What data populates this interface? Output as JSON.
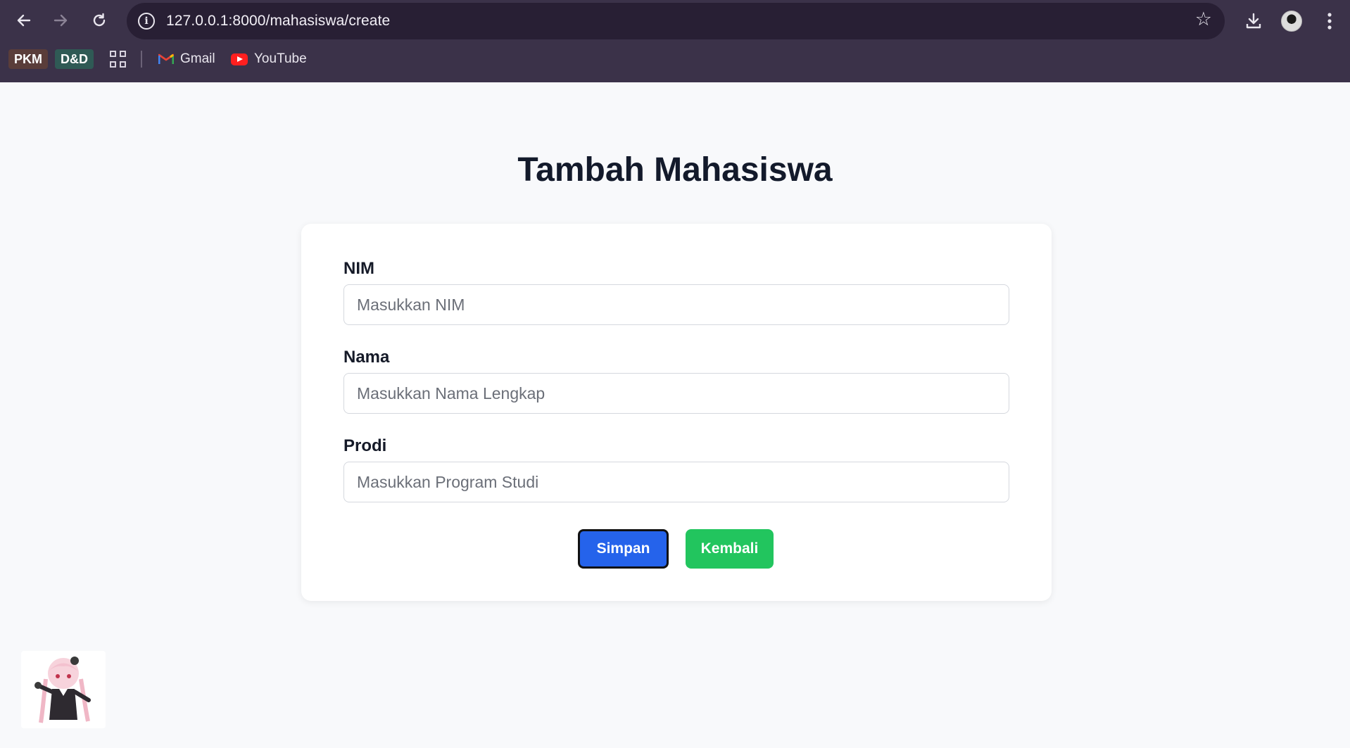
{
  "browser": {
    "url": "127.0.0.1:8000/mahasiswa/create",
    "bookmarks": [
      {
        "label": "PKM",
        "bg": "#5a3d3a"
      },
      {
        "label": "D&D",
        "bg": "#2f5a55"
      },
      {
        "label": "Gmail",
        "icon": "gmail-icon"
      },
      {
        "label": "YouTube",
        "icon": "youtube-icon"
      }
    ]
  },
  "page": {
    "title": "Tambah Mahasiswa",
    "fields": [
      {
        "label": "NIM",
        "placeholder": "Masukkan NIM",
        "value": ""
      },
      {
        "label": "Nama",
        "placeholder": "Masukkan Nama Lengkap",
        "value": ""
      },
      {
        "label": "Prodi",
        "placeholder": "Masukkan Program Studi",
        "value": ""
      }
    ],
    "buttons": {
      "save_label": "Simpan",
      "back_label": "Kembali"
    }
  },
  "colors": {
    "chrome_bg": "#3b3249",
    "page_bg": "#f8f9fb",
    "primary": "#2563eb",
    "success": "#22c55e"
  }
}
